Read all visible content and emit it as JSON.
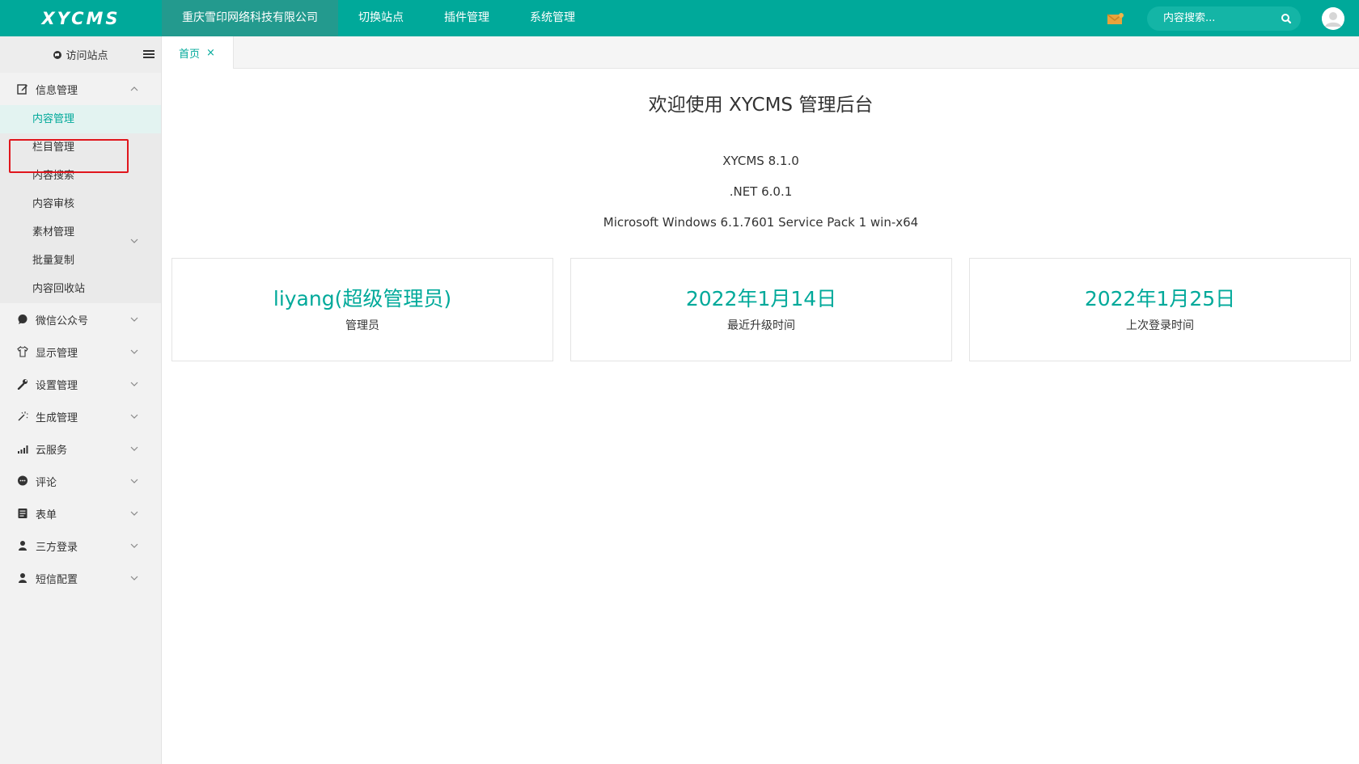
{
  "header": {
    "logo": "XYCMS",
    "nav": [
      {
        "label": "重庆雪印网络科技有限公司"
      },
      {
        "label": "切换站点"
      },
      {
        "label": "插件管理"
      },
      {
        "label": "系统管理"
      }
    ],
    "search_placeholder": "内容搜索..."
  },
  "sidebar": {
    "visit_label": "访问站点",
    "groups": [
      {
        "label": "信息管理",
        "icon": "edit-icon",
        "expanded": true,
        "children": [
          {
            "label": "内容管理",
            "active": true
          },
          {
            "label": "栏目管理"
          },
          {
            "label": "内容搜索"
          },
          {
            "label": "内容审核"
          },
          {
            "label": "素材管理",
            "has_children": true
          },
          {
            "label": "批量复制"
          },
          {
            "label": "内容回收站"
          }
        ]
      },
      {
        "label": "微信公众号",
        "icon": "chat-bubble-icon"
      },
      {
        "label": "显示管理",
        "icon": "shirt-icon"
      },
      {
        "label": "设置管理",
        "icon": "wrench-icon"
      },
      {
        "label": "生成管理",
        "icon": "magic-wand-icon"
      },
      {
        "label": "云服务",
        "icon": "signal-bars-icon"
      },
      {
        "label": "评论",
        "icon": "comment-icon"
      },
      {
        "label": "表单",
        "icon": "form-icon"
      },
      {
        "label": "三方登录",
        "icon": "user-icon"
      },
      {
        "label": "短信配置",
        "icon": "user-icon"
      }
    ]
  },
  "tabs": [
    {
      "label": "首页",
      "close": "×"
    }
  ],
  "main": {
    "welcome": "欢迎使用 XYCMS 管理后台",
    "version": "XYCMS 8.1.0",
    "runtime": ".NET 6.0.1",
    "os": "Microsoft Windows 6.1.7601 Service Pack 1 win-x64",
    "cards": [
      {
        "value": "liyang(超级管理员)",
        "label": "管理员"
      },
      {
        "value": "2022年1月14日",
        "label": "最近升级时间"
      },
      {
        "value": "2022年1月25日",
        "label": "上次登录时间"
      }
    ]
  },
  "colors": {
    "primary": "#00a99a",
    "highlight_border": "#e0161d"
  }
}
